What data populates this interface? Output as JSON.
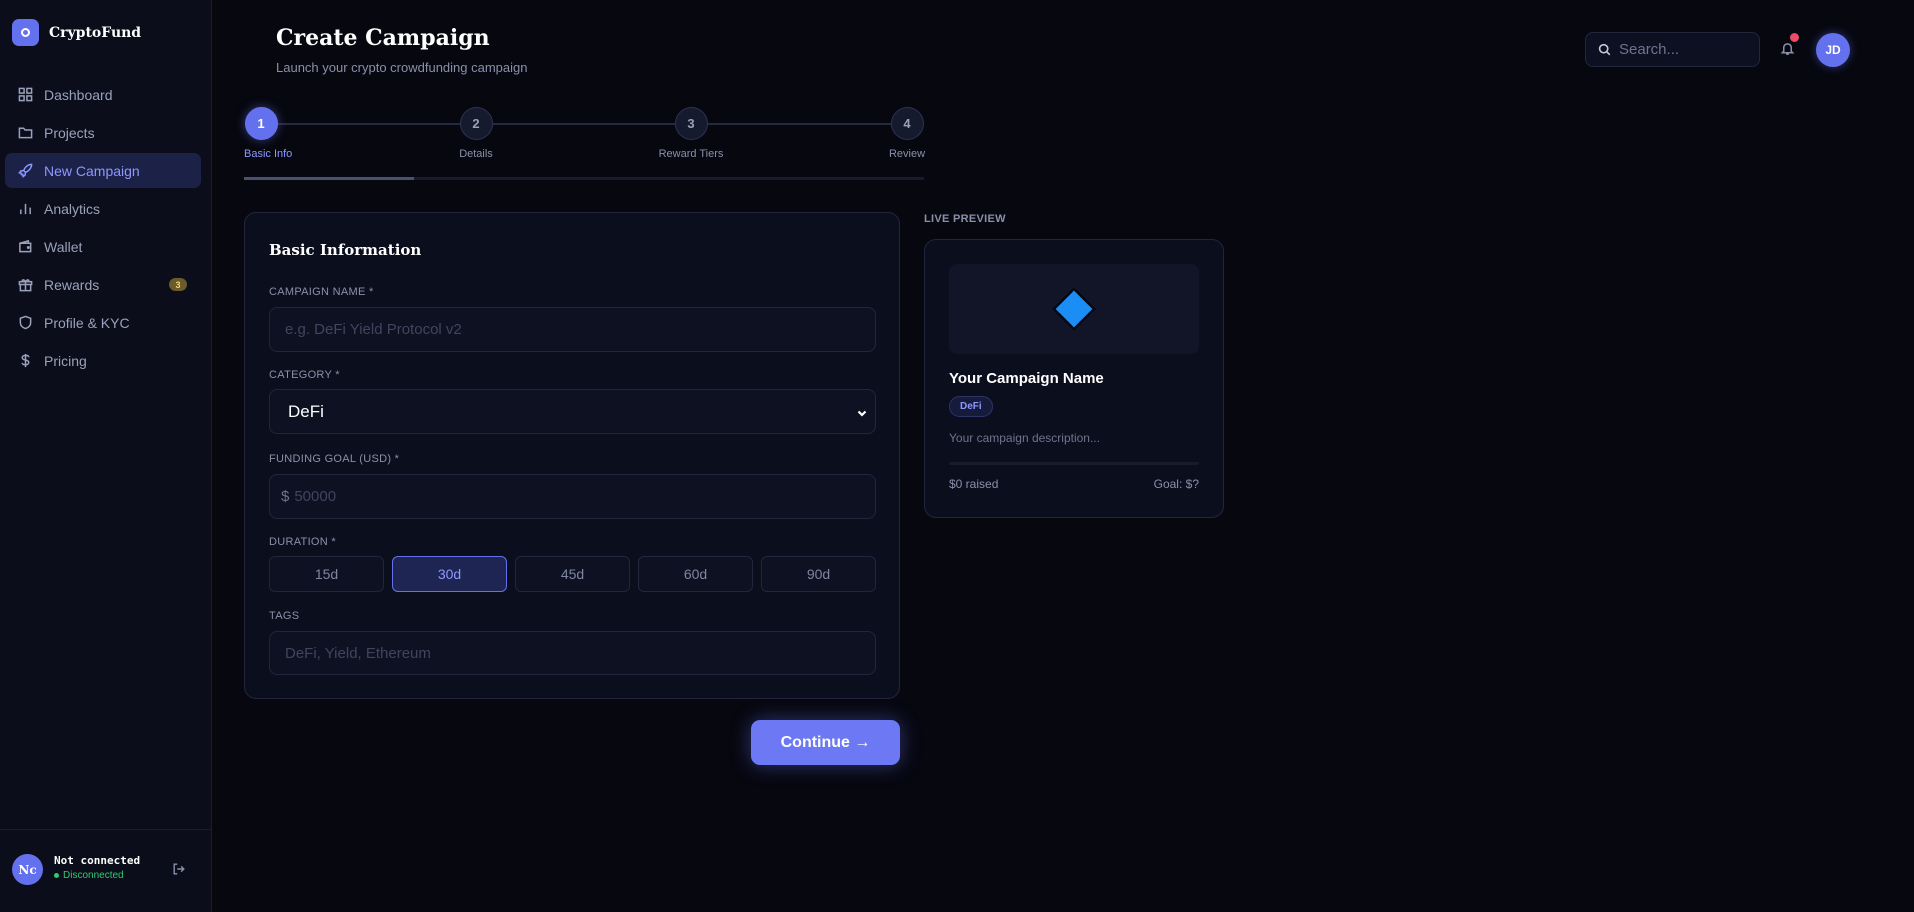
{
  "app": {
    "name": "CryptoFund"
  },
  "sidebar": {
    "items": [
      {
        "label": "Dashboard",
        "icon": "grid-icon"
      },
      {
        "label": "Projects",
        "icon": "folder-icon"
      },
      {
        "label": "New Campaign",
        "icon": "rocket-icon",
        "active": true
      },
      {
        "label": "Analytics",
        "icon": "bar-chart-icon"
      },
      {
        "label": "Wallet",
        "icon": "wallet-icon"
      },
      {
        "label": "Rewards",
        "icon": "gift-icon",
        "badge": "3"
      },
      {
        "label": "Profile & KYC",
        "icon": "shield-icon"
      },
      {
        "label": "Pricing",
        "icon": "dollar-icon"
      }
    ],
    "footer": {
      "initials": "Nc",
      "name": "Not connected",
      "status": "Disconnected"
    }
  },
  "header": {
    "title": "Create Campaign",
    "subtitle": "Launch your crypto crowdfunding campaign",
    "search_placeholder": "Search...",
    "user_initials": "JD"
  },
  "stepper": {
    "steps": [
      {
        "number": "1",
        "label": "Basic Info",
        "active": true
      },
      {
        "number": "2",
        "label": "Details"
      },
      {
        "number": "3",
        "label": "Reward Tiers"
      },
      {
        "number": "4",
        "label": "Review"
      }
    ],
    "progress": 0.25
  },
  "form": {
    "title": "Basic Information",
    "campaign_name": {
      "label": "CAMPAIGN NAME *",
      "placeholder": "e.g. DeFi Yield Protocol v2"
    },
    "category": {
      "label": "CATEGORY *",
      "value": "DeFi"
    },
    "funding_goal": {
      "label": "FUNDING GOAL (USD) *",
      "prefix": "$",
      "placeholder": "50000"
    },
    "duration": {
      "label": "DURATION *",
      "options": [
        "15d",
        "30d",
        "45d",
        "60d",
        "90d"
      ],
      "selected": "30d"
    },
    "tags": {
      "label": "TAGS",
      "placeholder": "DeFi, Yield, Ethereum"
    },
    "continue_label": "Continue →"
  },
  "preview": {
    "label": "LIVE PREVIEW",
    "name": "Your Campaign Name",
    "tag": "DeFi",
    "description": "Your campaign description...",
    "raised": "$0 raised",
    "goal": "Goal: $?"
  },
  "colors": {
    "accent": "#6471ee",
    "background": "#06070f",
    "success": "#2ecc71",
    "notification": "#ee4b6a"
  }
}
